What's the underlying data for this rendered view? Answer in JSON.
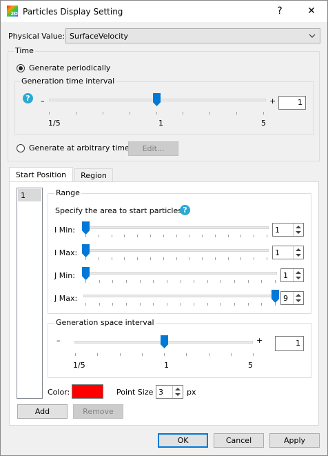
{
  "window": {
    "title": "Particles Display Setting",
    "icon_text": "2D",
    "help_glyph": "?",
    "close_glyph": "✕"
  },
  "physical_value": {
    "label": "Physical Value:",
    "selected": "SurfaceVelocity"
  },
  "time": {
    "group_label": "Time",
    "periodic_label": "Generate periodically",
    "periodic_selected": true,
    "interval_group_label": "Generation time interval",
    "minus": "–",
    "plus": "+",
    "value": "1",
    "slider_level_fraction": 0.5,
    "scale_labels": [
      "1/5",
      "1",
      "5"
    ],
    "arbitrary_label": "Generate at arbitrary time",
    "arbitrary_selected": false,
    "edit_button": "Edit..."
  },
  "tabs": [
    {
      "label": "Start Position",
      "active": true
    },
    {
      "label": "Region",
      "active": false
    }
  ],
  "start_list": [
    "1"
  ],
  "range": {
    "group_label": "Range",
    "instruction": "Specify the area to start particles",
    "rows": [
      {
        "label": "I Min:",
        "value": "1",
        "slider_fraction": 0.0
      },
      {
        "label": "I Max:",
        "value": "1",
        "slider_fraction": 0.0
      },
      {
        "label": "J Min:",
        "value": "1",
        "slider_fraction": 0.0
      },
      {
        "label": "J Max:",
        "value": "9",
        "slider_fraction": 1.0
      }
    ]
  },
  "space": {
    "group_label": "Generation space interval",
    "minus": "–",
    "plus": "+",
    "value": "1",
    "slider_level_fraction": 0.5,
    "scale_labels": [
      "1/5",
      "1",
      "5"
    ]
  },
  "color": {
    "label": "Color:",
    "value": "#ff0000"
  },
  "point_size": {
    "label": "Point Size",
    "value": "3",
    "unit": "px"
  },
  "list_buttons": {
    "add": "Add",
    "remove": "Remove"
  },
  "footer": {
    "ok": "OK",
    "cancel": "Cancel",
    "apply": "Apply"
  }
}
